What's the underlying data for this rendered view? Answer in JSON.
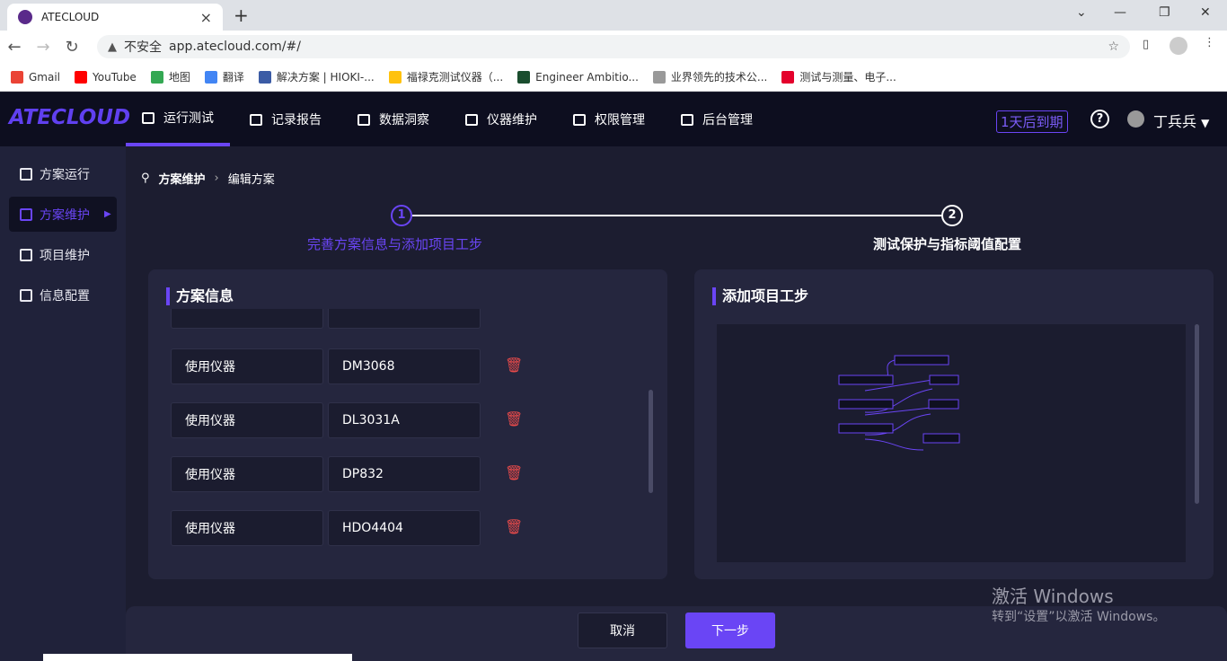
{
  "browser": {
    "tab_title": "ATECLOUD",
    "security": "不安全",
    "url": "app.atecloud.com/#/",
    "bookmarks": [
      {
        "label": "Gmail",
        "color": "#ea4335"
      },
      {
        "label": "YouTube",
        "color": "#ff0000"
      },
      {
        "label": "地图",
        "color": "#34a853"
      },
      {
        "label": "翻译",
        "color": "#4285f4"
      },
      {
        "label": "解决方案 | HIOKI-...",
        "color": "#3b5ba5"
      },
      {
        "label": "福禄克测试仪器（...",
        "color": "#ffc20e"
      },
      {
        "label": "Engineer Ambitio...",
        "color": "#1a4d2e"
      },
      {
        "label": "业界领先的技术公...",
        "color": "#999999"
      },
      {
        "label": "测试与测量、电子...",
        "color": "#e4002b"
      }
    ]
  },
  "app": {
    "logo": "ATECLOUD",
    "accent": "#6a45f5",
    "menu": [
      {
        "label": "运行测试",
        "active": true
      },
      {
        "label": "记录报告"
      },
      {
        "label": "数据洞察"
      },
      {
        "label": "仪器维护"
      },
      {
        "label": "权限管理"
      },
      {
        "label": "后台管理"
      }
    ],
    "expire": "1天后到期",
    "help": "?",
    "user": "丁兵兵"
  },
  "sidebar": [
    {
      "label": "方案运行"
    },
    {
      "label": "方案维护",
      "active": true
    },
    {
      "label": "项目维护"
    },
    {
      "label": "信息配置"
    }
  ],
  "breadcrumb": [
    "方案维护",
    "编辑方案"
  ],
  "steps": [
    {
      "num": "1",
      "label": "完善方案信息与添加项目工步",
      "active": true
    },
    {
      "num": "2",
      "label": "测试保护与指标阈值配置"
    }
  ],
  "scheme_card": {
    "title": "方案信息",
    "rows": [
      {
        "label": "使用仪器",
        "value": "DM3068"
      },
      {
        "label": "使用仪器",
        "value": "DL3031A"
      },
      {
        "label": "使用仪器",
        "value": "DP832"
      },
      {
        "label": "使用仪器",
        "value": "HDO4404"
      }
    ]
  },
  "steps_card": {
    "title": "添加项目工步"
  },
  "buttons": {
    "cancel": "取消",
    "next": "下一步"
  },
  "watermark": {
    "line1": "激活 Windows",
    "line2": "转到“设置”以激活 Windows。"
  }
}
